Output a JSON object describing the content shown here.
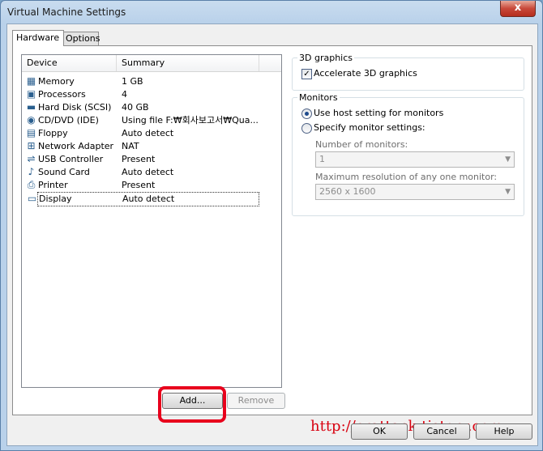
{
  "window": {
    "title": "Virtual Machine Settings",
    "close_label": "x"
  },
  "tabs": [
    {
      "label": "Hardware",
      "active": true
    },
    {
      "label": "Options",
      "active": false
    }
  ],
  "device_list": {
    "headers": {
      "device": "Device",
      "summary": "Summary"
    },
    "rows": [
      {
        "icon": "memory-icon",
        "name": "Memory",
        "summary": "1 GB"
      },
      {
        "icon": "processor-icon",
        "name": "Processors",
        "summary": "4"
      },
      {
        "icon": "hard-disk-icon",
        "name": "Hard Disk (SCSI)",
        "summary": "40 GB"
      },
      {
        "icon": "cd-dvd-icon",
        "name": "CD/DVD (IDE)",
        "summary": "Using file F:₩회사보고서₩Qua..."
      },
      {
        "icon": "floppy-icon",
        "name": "Floppy",
        "summary": "Auto detect"
      },
      {
        "icon": "network-adapter-icon",
        "name": "Network Adapter",
        "summary": "NAT"
      },
      {
        "icon": "usb-controller-icon",
        "name": "USB Controller",
        "summary": "Present"
      },
      {
        "icon": "sound-card-icon",
        "name": "Sound Card",
        "summary": "Auto detect"
      },
      {
        "icon": "printer-icon",
        "name": "Printer",
        "summary": "Present"
      },
      {
        "icon": "display-icon",
        "name": "Display",
        "summary": "Auto detect",
        "selected": true
      }
    ],
    "add_label": "Add...",
    "remove_label": "Remove"
  },
  "graphics_3d": {
    "legend": "3D graphics",
    "accelerate_label": "Accelerate 3D graphics",
    "accelerate_checked": true
  },
  "monitors": {
    "legend": "Monitors",
    "use_host_label": "Use host setting for monitors",
    "specify_label": "Specify monitor settings:",
    "selected_option": "use_host",
    "num_monitors_label": "Number of monitors:",
    "num_monitors_value": "1",
    "max_res_label": "Maximum resolution of any one monitor:",
    "max_res_value": "2560 x 1600"
  },
  "watermark": "http://crattack.tistory.com",
  "footer": {
    "ok_label": "OK",
    "cancel_label": "Cancel",
    "help_label": "Help"
  },
  "colors": {
    "highlight": "#e8001c",
    "watermark": "#d8000f",
    "title_bar": "#b9d1ea"
  }
}
